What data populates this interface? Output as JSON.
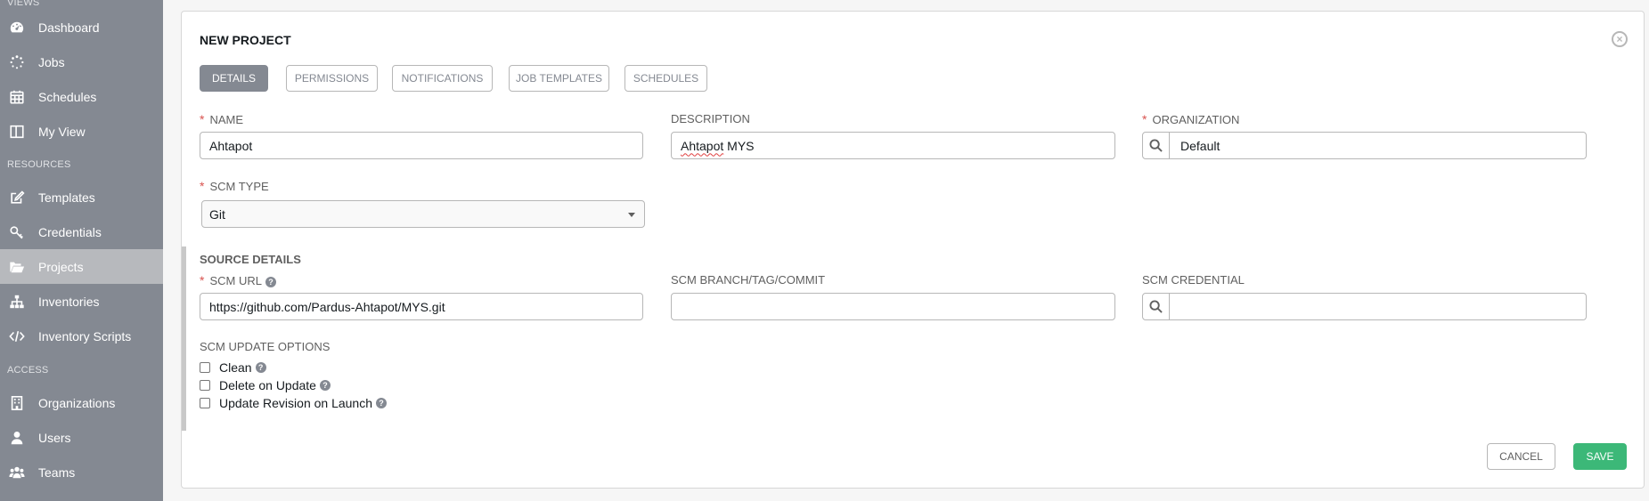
{
  "sidebar": {
    "sections": {
      "views": "VIEWS",
      "resources": "RESOURCES",
      "access": "ACCESS"
    },
    "items": [
      {
        "label": "Dashboard",
        "icon": "dashboard-icon"
      },
      {
        "label": "Jobs",
        "icon": "jobs-spinner-icon"
      },
      {
        "label": "Schedules",
        "icon": "calendar-icon"
      },
      {
        "label": "My View",
        "icon": "columns-icon"
      },
      {
        "label": "Templates",
        "icon": "pencil-square-icon"
      },
      {
        "label": "Credentials",
        "icon": "key-icon"
      },
      {
        "label": "Projects",
        "icon": "folder-open-icon",
        "active": true
      },
      {
        "label": "Inventories",
        "icon": "sitemap-icon"
      },
      {
        "label": "Inventory Scripts",
        "icon": "code-icon"
      },
      {
        "label": "Organizations",
        "icon": "building-icon"
      },
      {
        "label": "Users",
        "icon": "user-icon"
      },
      {
        "label": "Teams",
        "icon": "users-icon"
      }
    ]
  },
  "panel": {
    "title": "NEW PROJECT",
    "tabs": [
      {
        "label": "DETAILS",
        "active": true
      },
      {
        "label": "PERMISSIONS"
      },
      {
        "label": "NOTIFICATIONS"
      },
      {
        "label": "JOB TEMPLATES"
      },
      {
        "label": "SCHEDULES"
      }
    ]
  },
  "form": {
    "name": {
      "label": "NAME",
      "value": "Ahtapot",
      "required": "*"
    },
    "description": {
      "label": "DESCRIPTION",
      "value_word1": "Ahtapot",
      "value_word2": " MYS"
    },
    "organization": {
      "label": "ORGANIZATION",
      "value": "Default",
      "required": "*"
    },
    "scm_type": {
      "label": "SCM TYPE",
      "value": "Git",
      "required": "*"
    },
    "source_details": {
      "title": "SOURCE DETAILS"
    },
    "scm_url": {
      "label": "SCM URL",
      "value": "https://github.com/Pardus-Ahtapot/MYS.git",
      "required": "*"
    },
    "scm_branch": {
      "label": "SCM BRANCH/TAG/COMMIT",
      "value": ""
    },
    "scm_credential": {
      "label": "SCM CREDENTIAL",
      "value": ""
    },
    "update_options": {
      "label": "SCM UPDATE OPTIONS",
      "clean": "Clean",
      "delete_on_update": "Delete on Update",
      "update_on_launch": "Update Revision on Launch"
    },
    "help_glyph": "?"
  },
  "actions": {
    "cancel": "CANCEL",
    "save": "SAVE"
  },
  "colors": {
    "sidebar": "#848992",
    "active_item": "#b7b9bd",
    "save": "#3cb878",
    "required": "#d9534f"
  }
}
